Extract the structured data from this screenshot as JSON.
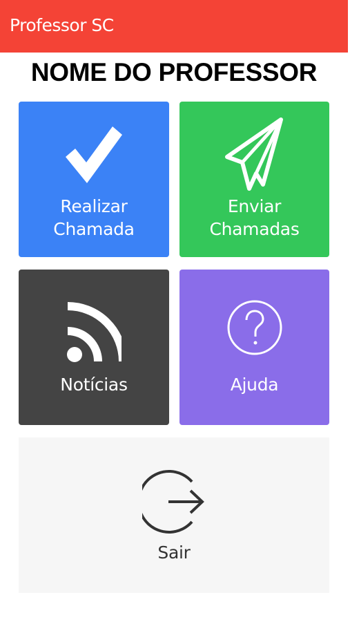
{
  "app_bar": {
    "title": "Professor SC",
    "color": "#f44336"
  },
  "page_title": "NOME DO PROFESSOR",
  "menu": {
    "take_attendance": {
      "line1": "Realizar",
      "line2": "Chamada",
      "icon": "checkmark-icon",
      "color": "#3b82f6"
    },
    "send_attendance": {
      "line1": "Enviar",
      "line2": "Chamadas",
      "icon": "paper-plane-icon",
      "color": "#34c75a"
    },
    "news": {
      "label": "Notícias",
      "icon": "rss-feed-icon",
      "color": "#444444"
    },
    "help": {
      "label": "Ajuda",
      "icon": "question-circle-icon",
      "color": "#8a6de9"
    },
    "logout": {
      "label": "Sair",
      "icon": "logout-arrow-icon",
      "color": "#f6f6f6"
    }
  }
}
